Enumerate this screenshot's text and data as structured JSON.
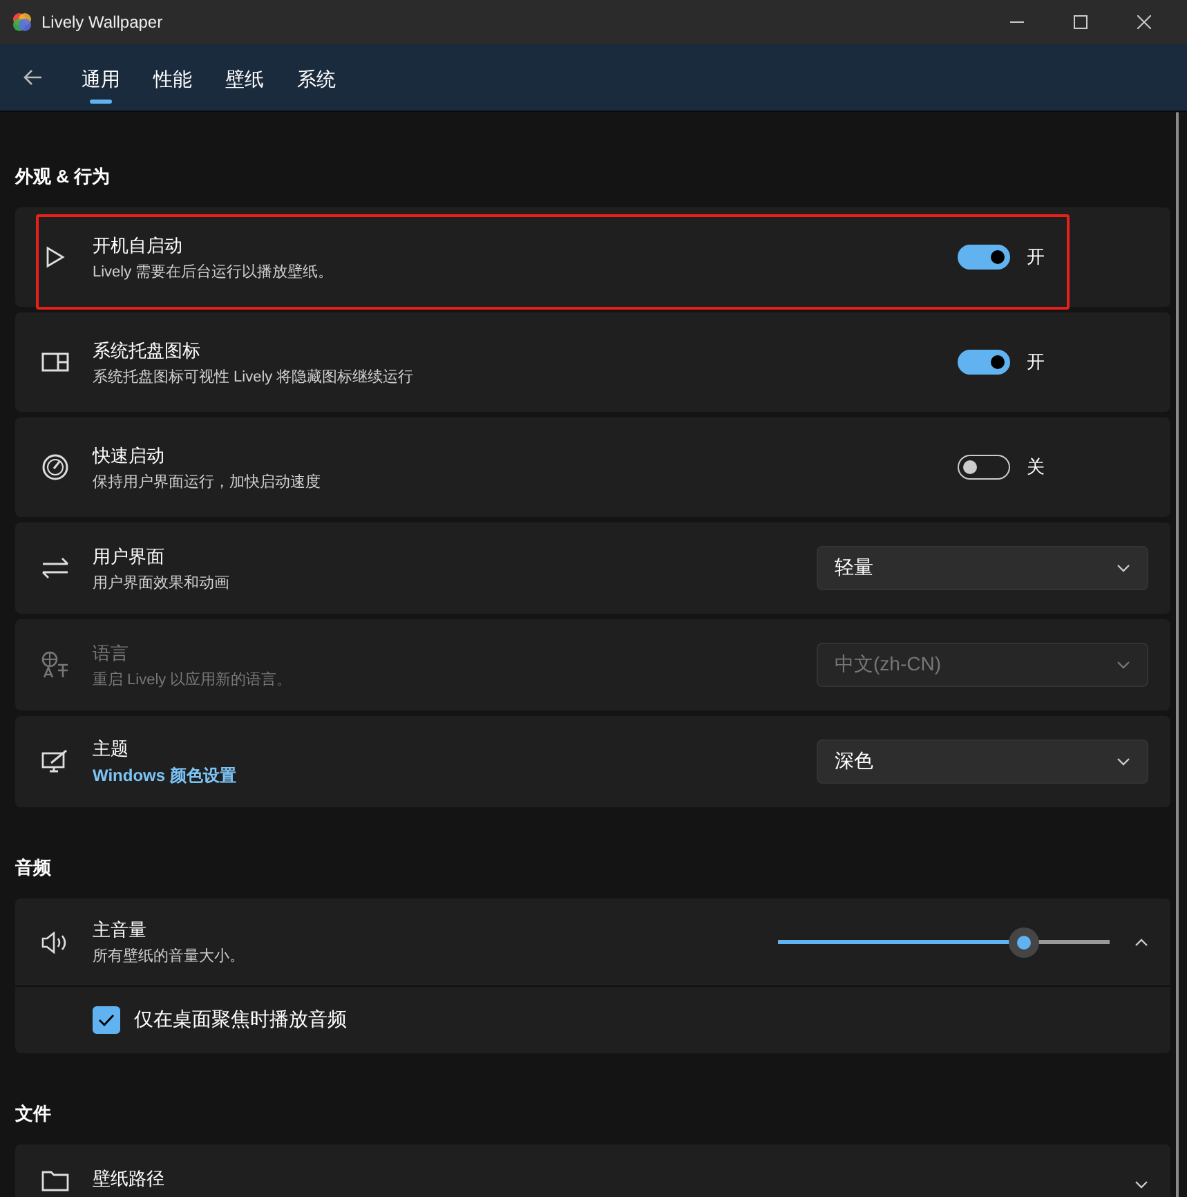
{
  "window": {
    "title": "Lively Wallpaper"
  },
  "tabs": [
    {
      "label": "通用",
      "selected": true
    },
    {
      "label": "性能",
      "selected": false
    },
    {
      "label": "壁纸",
      "selected": false
    },
    {
      "label": "系统",
      "selected": false
    }
  ],
  "sections": [
    {
      "heading": "外观 & 行为",
      "rows": [
        {
          "kind": "toggle",
          "title": "开机自启动",
          "subtitle": "Lively 需要在后台运行以播放壁纸。",
          "on": true,
          "state_label": "开",
          "highlighted": true,
          "disabled": false
        },
        {
          "kind": "toggle",
          "title": "系统托盘图标",
          "subtitle": "系统托盘图标可视性 Lively 将隐藏图标继续运行",
          "on": true,
          "state_label": "开",
          "highlighted": false,
          "disabled": false
        },
        {
          "kind": "toggle",
          "title": "快速启动",
          "subtitle": "保持用户界面运行，加快启动速度",
          "on": false,
          "state_label": "关",
          "highlighted": false,
          "disabled": false
        },
        {
          "kind": "dropdown",
          "title": "用户界面",
          "subtitle": "用户界面效果和动画",
          "value": "轻量",
          "highlighted": false,
          "disabled": false
        },
        {
          "kind": "dropdown",
          "title": "语言",
          "subtitle": "重启 Lively 以应用新的语言。",
          "value": "中文(zh-CN)",
          "highlighted": false,
          "disabled": true
        },
        {
          "kind": "dropdown",
          "title": "主题",
          "link": "Windows 颜色设置",
          "value": "深色",
          "highlighted": false,
          "disabled": false
        }
      ]
    },
    {
      "heading": "音频",
      "rows": [
        {
          "kind": "slider",
          "title": "主音量",
          "subtitle": "所有壁纸的音量大小。",
          "level": 0.74,
          "expanded": true,
          "highlighted": false,
          "disabled": false,
          "options": [
            {
              "label": "仅在桌面聚焦时播放音频",
              "checked": true
            }
          ]
        }
      ]
    },
    {
      "heading": "文件",
      "rows": [
        {
          "kind": "expander",
          "title": "壁纸路径",
          "expanded": false,
          "highlighted": false,
          "disabled": false
        }
      ]
    }
  ]
}
